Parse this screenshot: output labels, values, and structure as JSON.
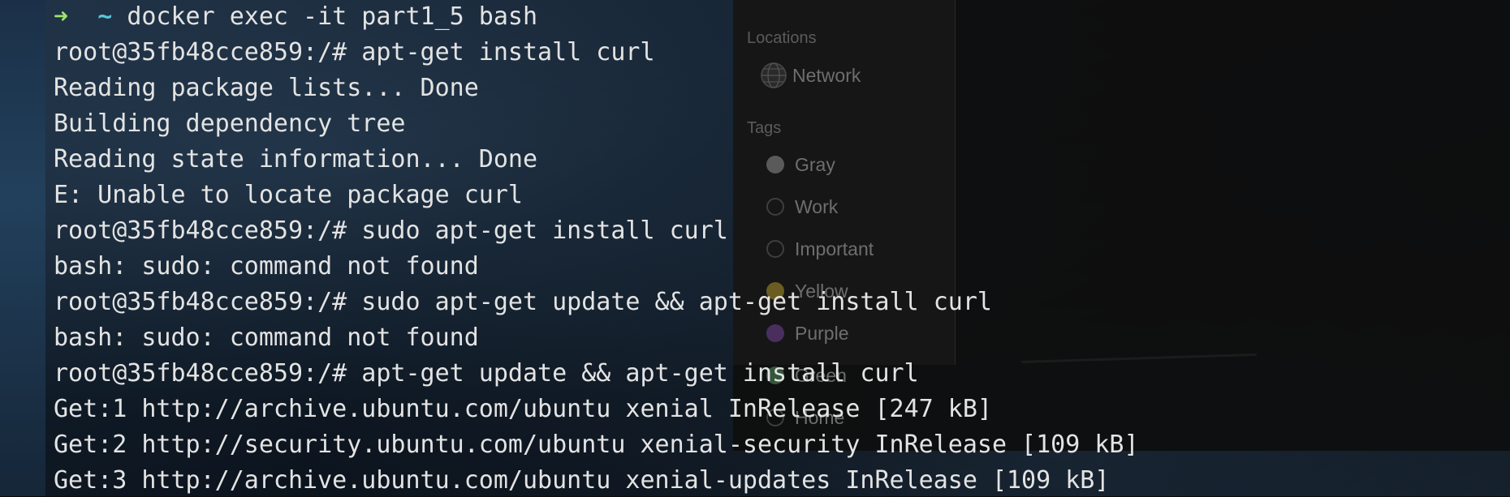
{
  "finder": {
    "locations_heading": "Locations",
    "network_label": "Network",
    "tags_heading": "Tags",
    "tags": [
      {
        "label": "Gray",
        "color": "#5a5a5a"
      },
      {
        "label": "Work",
        "color": "transparent"
      },
      {
        "label": "Important",
        "color": "transparent"
      },
      {
        "label": "Yellow",
        "color": "#6b5d21"
      },
      {
        "label": "Purple",
        "color": "#4a2f5e"
      },
      {
        "label": "Green",
        "color": "#35563a"
      },
      {
        "label": "Home",
        "color": "transparent"
      }
    ]
  },
  "terminal": {
    "prompt_arrow": "➜",
    "prompt_dir": "~",
    "first_command": "docker exec -it part1_5 bash",
    "lines": [
      "root@35fb48cce859:/# apt-get install curl",
      "Reading package lists... Done",
      "Building dependency tree",
      "Reading state information... Done",
      "E: Unable to locate package curl",
      "root@35fb48cce859:/# sudo apt-get install curl",
      "bash: sudo: command not found",
      "root@35fb48cce859:/# sudo apt-get update && apt-get install curl",
      "bash: sudo: command not found",
      "root@35fb48cce859:/# apt-get update && apt-get install curl",
      "Get:1 http://archive.ubuntu.com/ubuntu xenial InRelease [247 kB]",
      "Get:2 http://security.ubuntu.com/ubuntu xenial-security InRelease [109 kB]",
      "Get:3 http://archive.ubuntu.com/ubuntu xenial-updates InRelease [109 kB]"
    ]
  }
}
